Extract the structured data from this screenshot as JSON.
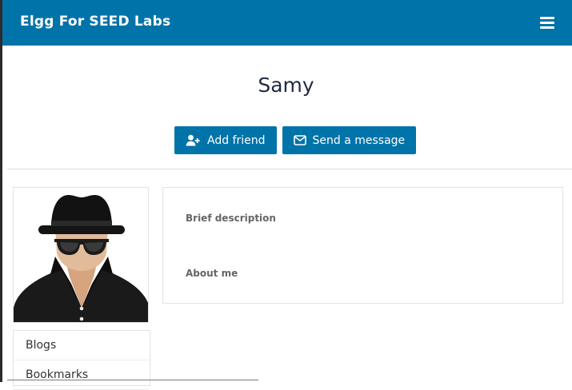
{
  "header": {
    "site_title": "Elgg For SEED Labs",
    "menu_icon": "hamburger-icon",
    "bg_color": "#0073a8"
  },
  "profile": {
    "name": "Samy",
    "actions": {
      "add_friend_label": "Add friend",
      "add_friend_icon": "user-plus-icon",
      "send_message_label": "Send a message",
      "send_message_icon": "envelope-icon"
    },
    "avatar_icon": "spy-avatar-icon",
    "fields": {
      "brief_description_label": "Brief description",
      "about_me_label": "About me"
    }
  },
  "sidebar": {
    "items": [
      {
        "label": "Blogs"
      },
      {
        "label": "Bookmarks"
      }
    ]
  }
}
